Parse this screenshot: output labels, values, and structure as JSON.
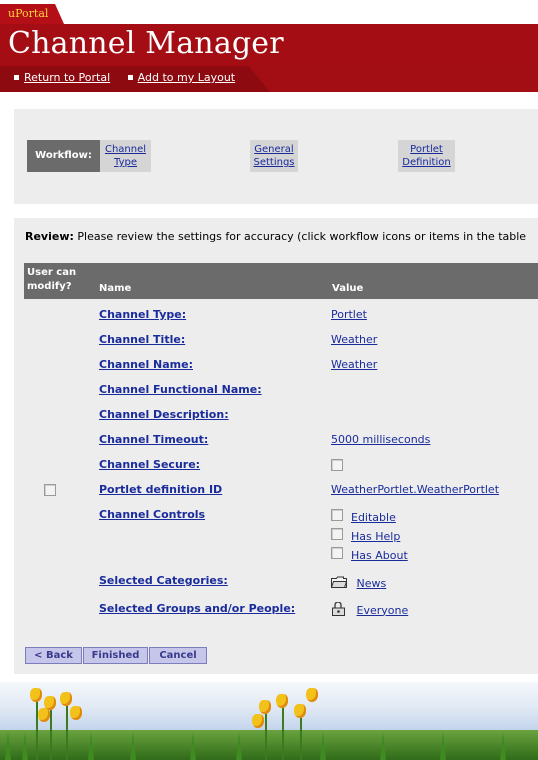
{
  "portal": {
    "tab_label": "uPortal",
    "title": "Channel Manager",
    "links": [
      {
        "label": "Return to Portal"
      },
      {
        "label": "Add to my Layout"
      }
    ]
  },
  "workflow": {
    "label": "Workflow:",
    "steps": [
      {
        "line1": "Channel",
        "line2": "Type"
      },
      {
        "line1": "General",
        "line2": "Settings"
      },
      {
        "line1": "Portlet",
        "line2": "Definition"
      }
    ]
  },
  "review": {
    "bold": "Review:",
    "text": "Please review the settings for accuracy (click workflow icons or items in the table"
  },
  "table": {
    "headers": {
      "modify_line1": "User can",
      "modify_line2": "modify?",
      "name": "Name",
      "value": "Value"
    },
    "rows": [
      {
        "name": "Channel Type:",
        "value": "Portlet"
      },
      {
        "name": "Channel Title:",
        "value": "Weather"
      },
      {
        "name": "Channel Name:",
        "value": "Weather"
      },
      {
        "name": "Channel Functional Name:",
        "value": ""
      },
      {
        "name": "Channel Description:",
        "value": ""
      },
      {
        "name": "Channel Timeout:",
        "value": "5000 milliseconds"
      },
      {
        "name": "Channel Secure:",
        "value": ""
      },
      {
        "name": "Portlet definition ID",
        "value": "WeatherPortlet.WeatherPortlet"
      },
      {
        "name": "Channel Controls",
        "value": ""
      },
      {
        "name": "Selected Categories:",
        "value": "News"
      },
      {
        "name": "Selected Groups and/or People:",
        "value": "Everyone"
      }
    ],
    "controls": [
      "Editable",
      "Has Help",
      "Has About"
    ]
  },
  "buttons": {
    "back": "< Back",
    "finished": "Finished",
    "cancel": "Cancel"
  },
  "icons": {
    "category": "folder-icon",
    "group": "group-lock-icon"
  },
  "colors": {
    "header_red": "#a30d14",
    "link_blue": "#1a2b9c",
    "header_gray": "#6b6b6b"
  }
}
